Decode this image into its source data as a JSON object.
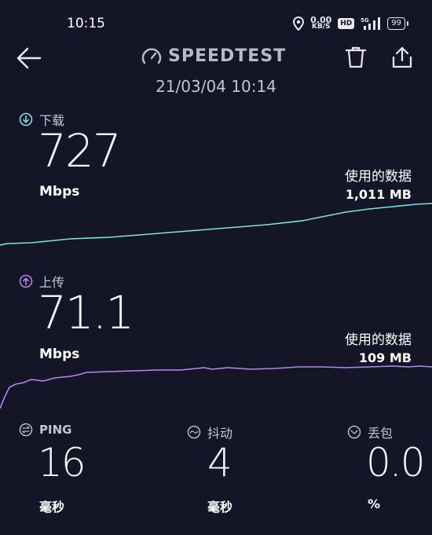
{
  "status_bar": {
    "time": "10:15",
    "net_speed_value": "0.00",
    "net_speed_unit": "KB/S",
    "hd_badge": "HD",
    "network": "5G",
    "battery": "99"
  },
  "header": {
    "brand": "SPEEDTEST",
    "date": "21/03/04 10:14"
  },
  "download": {
    "label": "下载",
    "value": "727",
    "unit": "Mbps",
    "used_label": "使用的数据",
    "used_value": "1,011 MB",
    "color": "#7fe3d6"
  },
  "upload": {
    "label": "上传",
    "value": "71.1",
    "unit": "Mbps",
    "used_label": "使用的数据",
    "used_value": "109 MB",
    "color": "#b784f0"
  },
  "stats": {
    "ping": {
      "label": "PING",
      "value": "16",
      "unit": "毫秒"
    },
    "jitter": {
      "label": "抖动",
      "value": "4",
      "unit": "毫秒"
    },
    "loss": {
      "label": "丢包",
      "value": "0.0",
      "unit": "%"
    }
  },
  "icons": [
    "location-icon",
    "hd-icon",
    "signal-icon",
    "battery-icon",
    "back-arrow-icon",
    "speedometer-icon",
    "trash-icon",
    "share-icon",
    "download-icon",
    "upload-icon",
    "ping-icon",
    "jitter-icon",
    "packet-loss-icon"
  ]
}
